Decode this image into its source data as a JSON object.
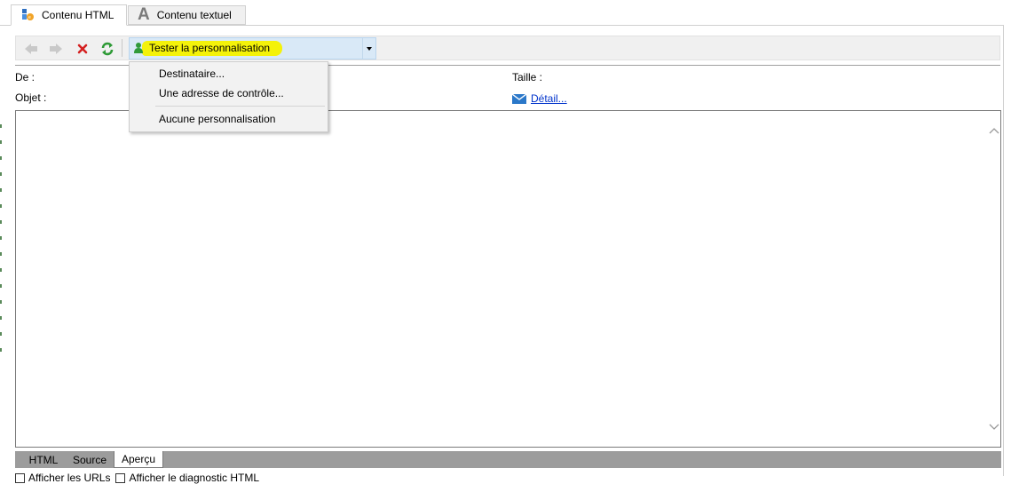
{
  "tabs": [
    {
      "label": "Contenu HTML",
      "icon": "html-content-icon",
      "active": true
    },
    {
      "label": "Contenu textuel",
      "icon": "text-content-icon",
      "active": false
    }
  ],
  "toolbar": {
    "back_icon": "arrow-left-icon",
    "forward_icon": "arrow-right-icon",
    "stop_icon": "red-x-icon",
    "refresh_icon": "refresh-icon",
    "personalisation": {
      "label": "Tester la personnalisation",
      "icon": "person-icon",
      "highlight_color": "#f4f20a"
    }
  },
  "menu": {
    "items": [
      "Destinataire...",
      "Une adresse de contrôle...",
      "Aucune personnalisation"
    ]
  },
  "fields": {
    "from_label": "De :",
    "subject_label": "Objet :",
    "size_label": "Taille :",
    "detail_link": "Détail..."
  },
  "bottom_tabs": [
    {
      "label": "HTML",
      "active": false
    },
    {
      "label": "Source",
      "active": false
    },
    {
      "label": "Aperçu",
      "active": true
    }
  ],
  "checkboxes": [
    "Afficher les URLs",
    "Afficher le diagnostic HTML"
  ]
}
